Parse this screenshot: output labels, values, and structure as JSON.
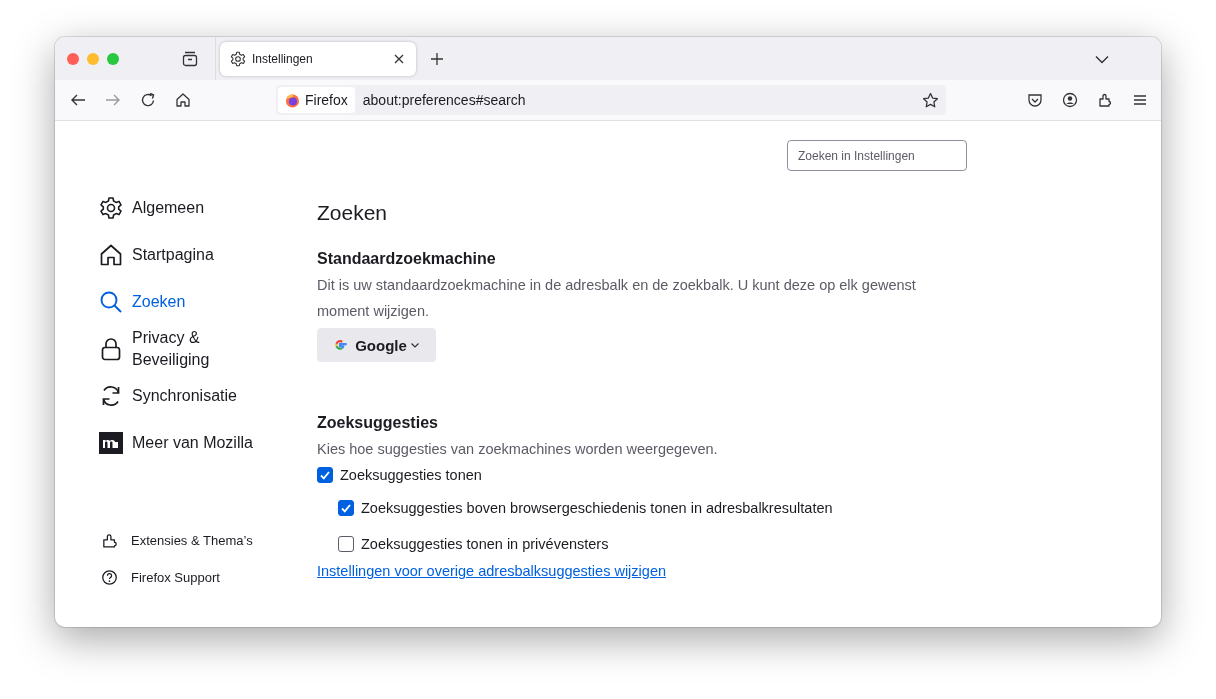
{
  "tabs": [
    {
      "title": "Instellingen",
      "selected": true
    }
  ],
  "toolbar": {
    "identity": "Firefox",
    "url": "about:preferences#search"
  },
  "search": {
    "placeholder": "Zoeken in Instellingen"
  },
  "sidebar": {
    "items": [
      {
        "kind": "general",
        "label": "Algemeen",
        "selected": false
      },
      {
        "kind": "home",
        "label": "Startpagina",
        "selected": false
      },
      {
        "kind": "search",
        "label": "Zoeken",
        "selected": true
      },
      {
        "kind": "privacy",
        "label": "Privacy & Beveiliging",
        "selected": false
      },
      {
        "kind": "sync",
        "label": "Synchronisatie",
        "selected": false
      },
      {
        "kind": "more",
        "label": "Meer van Mozilla",
        "selected": false
      }
    ],
    "footer": [
      {
        "kind": "addons",
        "label": "Extensies & Thema’s"
      },
      {
        "kind": "support",
        "label": "Firefox Support"
      }
    ]
  },
  "page": {
    "title": "Zoeken",
    "default_engine": {
      "heading": "Standaardzoekmachine",
      "description": "Dit is uw standaardzoekmachine in de adresbalk en de zoekbalk. U kunt deze op elk gewenst moment wijzigen.",
      "engine": "Google"
    },
    "suggestions": {
      "heading": "Zoeksuggesties",
      "description": "Kies hoe suggesties van zoekmachines worden weergegeven.",
      "options": [
        {
          "label": "Zoeksuggesties tonen",
          "checked": true,
          "children": [
            {
              "label": "Zoeksuggesties boven browsergeschiedenis tonen in adresbalkresultaten",
              "checked": true
            },
            {
              "label": "Zoeksuggesties tonen in privévensters",
              "checked": false
            }
          ]
        }
      ],
      "link": "Instellingen voor overige adresbalksuggesties wijzigen"
    }
  }
}
